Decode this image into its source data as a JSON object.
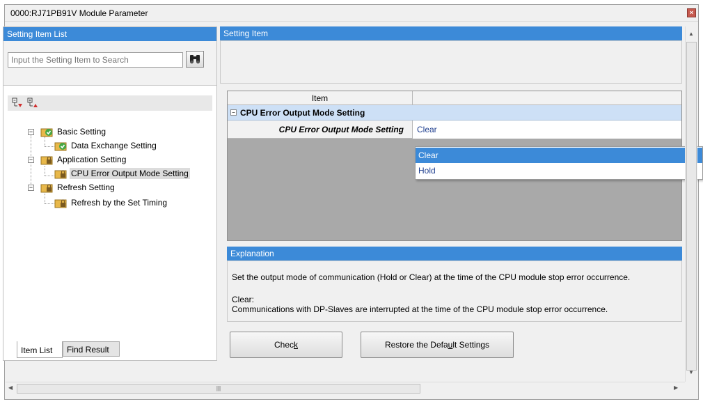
{
  "window": {
    "title": "0000:RJ71PB91V Module Parameter",
    "close_glyph": "×"
  },
  "left_pane": {
    "header": "Setting Item List",
    "search": {
      "placeholder": "Input the Setting Item to Search",
      "button_icon": "binoculars-icon"
    },
    "toolbar": {
      "expand_icon": "expand-all-icon",
      "collapse_icon": "collapse-all-icon"
    },
    "tree": [
      {
        "label": "Basic Setting",
        "icon": "check-folder-icon",
        "level": 0
      },
      {
        "label": "Data Exchange Setting",
        "icon": "check-folder-icon",
        "level": 1
      },
      {
        "label": "Application Setting",
        "icon": "lock-folder-icon",
        "level": 0
      },
      {
        "label": "CPU Error Output Mode Setting",
        "icon": "lock-folder-icon",
        "level": 1,
        "selected": true
      },
      {
        "label": "Refresh Setting",
        "icon": "lock-folder-icon",
        "level": 0
      },
      {
        "label": "Refresh by the Set Timing",
        "icon": "lock-folder-icon",
        "level": 1
      }
    ],
    "tabs": [
      "Item List",
      "Find Result"
    ]
  },
  "right_pane": {
    "header": "Setting Item",
    "grid": {
      "column_item": "Item",
      "group_label": "CPU Error Output Mode Setting",
      "item_label": "CPU Error Output Mode Setting",
      "item_value": "Clear"
    },
    "dropdown": {
      "options": [
        "Clear",
        "Hold"
      ],
      "selected": "Clear"
    },
    "explanation": {
      "header": "Explanation",
      "line1": "Set the output mode of communication (Hold or Clear) at the time of the CPU module stop error occurrence.",
      "line2": "Clear:",
      "line3": "Communications with DP-Slaves are interrupted at the time of the CPU module stop error occurrence."
    },
    "buttons": {
      "check_pre": "Chec",
      "check_acc": "k",
      "check_post": "",
      "restore_pre": "Restore the Defa",
      "restore_acc": "u",
      "restore_post": "lt Settings"
    }
  },
  "colors": {
    "header_blue": "#3c8ad8",
    "grid_group_bg": "#cde0f6",
    "value_text": "#1f3f8f"
  }
}
